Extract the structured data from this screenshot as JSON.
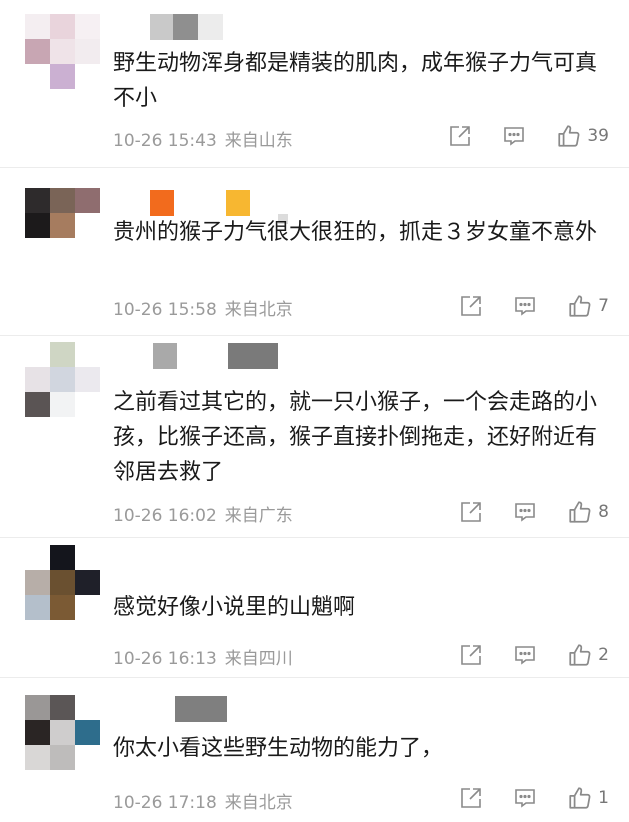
{
  "comments": [
    {
      "text": "野生动物浑身都是精装的肌肉，成年猴子力气可真不小",
      "time": "10-26 15:43",
      "location": "来自山东",
      "likes": "39"
    },
    {
      "text": "贵州的猴子力气很大很狂的，抓走３岁女童不意外",
      "time": "10-26 15:58",
      "location": "来自北京",
      "likes": "7"
    },
    {
      "text": "之前看过其它的，就一只小猴子，一个会走路的小孩，比猴子还高，猴子直接扑倒拖走，还好附近有邻居去救了",
      "time": "10-26 16:02",
      "location": "来自广东",
      "likes": "8"
    },
    {
      "text": "感觉好像小说里的山魈啊",
      "time": "10-26 16:13",
      "location": "来自四川",
      "likes": "2"
    },
    {
      "text": "你太小看这些野生动物的能力了，",
      "time": "10-26 17:18",
      "location": "来自北京",
      "likes": "1"
    }
  ],
  "icons": {
    "share": "share-icon",
    "reply": "comment-icon",
    "like": "thumbs-up-icon"
  },
  "colors": {
    "meta_text": "#9a9a9a",
    "icon_stroke": "#8a8a8a",
    "orange_badge": "#f26b1d",
    "yellow_badge": "#f7b731"
  }
}
